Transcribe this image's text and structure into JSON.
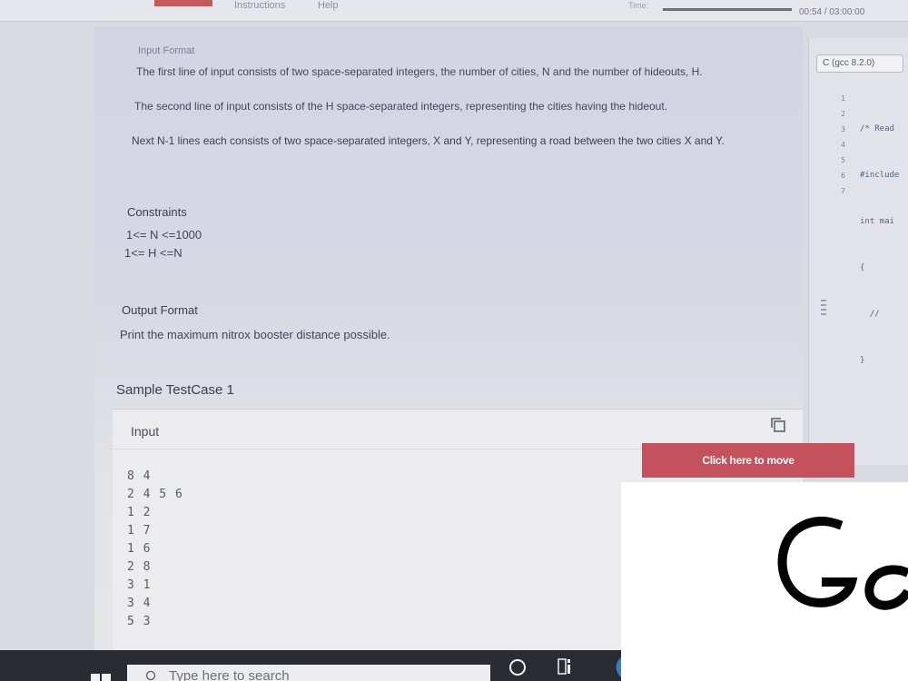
{
  "topbar": {
    "menu": [
      "Instructions",
      "Help"
    ],
    "time_label": "Time:",
    "time_value": "00:54 / 03:00:00"
  },
  "problem": {
    "input_format": {
      "title": "Input Format",
      "lines": [
        "The first line of input consists of two space-separated integers, the number of cities, N and the number of hideouts, H.",
        "The second line of input consists of the H space-separated integers, representing the cities having the hideout.",
        "Next N-1 lines each consists of two space-separated integers, X and Y, representing a road between the two cities X and Y."
      ]
    },
    "constraints": {
      "title": "Constraints",
      "lines": [
        "1<= N <=1000",
        "1<= H <=N"
      ]
    },
    "output_format": {
      "title": "Output Format",
      "text": "Print the maximum nitrox booster distance possible."
    },
    "sample": {
      "title": "Sample TestCase 1",
      "input_label": "Input",
      "input_lines": [
        "8 4",
        "2 4 5 6",
        "1 2",
        "1 7",
        "1 6",
        "2 8",
        "3 1",
        "3 4",
        "5 3"
      ]
    }
  },
  "editor": {
    "language": "C (gcc 8.2.0)",
    "line_numbers": [
      "1",
      "2",
      "3",
      "4",
      "5",
      "6",
      "7"
    ],
    "code_lines": [
      "/* Read",
      "#include",
      "int mai",
      "{",
      "  //",
      "}",
      ""
    ]
  },
  "move_button": {
    "label": "Click here to move"
  },
  "taskbar": {
    "search_placeholder": "Type here to search"
  },
  "icons": {
    "copy": "copy-icon",
    "start": "windows-start-icon",
    "search": "search-icon",
    "cortana": "cortana-icon",
    "task_view": "task-view-icon",
    "edge": "edge-icon"
  },
  "colors": {
    "accent": "#c4515b",
    "taskbar": "#2b2b34"
  }
}
